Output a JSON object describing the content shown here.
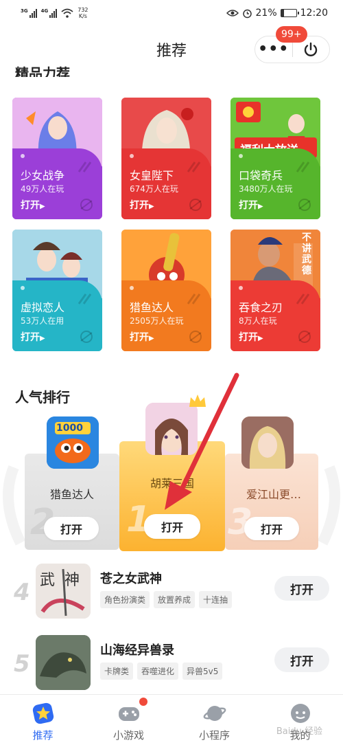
{
  "status_bar": {
    "signal1": "3G",
    "signal2": "4G",
    "speed_value": "732",
    "speed_unit": "K/s",
    "battery": "21%",
    "battery_level": 0.21,
    "time": "12:20"
  },
  "header": {
    "title": "推荐",
    "more_label": "•••",
    "badge": "99+"
  },
  "featured": {
    "section_title": "精品力荐",
    "games": [
      {
        "name": "少女战争",
        "count": "49万人在玩",
        "open": "打开",
        "color": "#9b3fd8",
        "art": "anime-warrior-girl"
      },
      {
        "name": "女皇陛下",
        "count": "674万人在玩",
        "open": "打开",
        "color": "#e53535",
        "art": "empress-girl"
      },
      {
        "name": "口袋奇兵",
        "count": "3480万人在玩",
        "open": "打开",
        "color": "#56b52c",
        "art": "welfare-banner",
        "art_text": "福利大放送"
      },
      {
        "name": "虚拟恋人",
        "count": "53万人在用",
        "open": "打开",
        "color": "#25b5c7",
        "art": "anime-couple"
      },
      {
        "name": "猎鱼达人",
        "count": "2505万人在玩",
        "open": "打开",
        "color": "#f27a1f",
        "art": "fishing-cannon"
      },
      {
        "name": "吞食之刃",
        "count": "8万人在玩",
        "open": "打开",
        "color": "#ec3b35",
        "art": "warrior-general",
        "art_text": "不讲武德"
      }
    ]
  },
  "ranking": {
    "section_title": "人气排行",
    "podium": [
      {
        "rank": "2",
        "name": "猎鱼达人",
        "open": "打开",
        "art": "fish-1000",
        "art_text": "1000"
      },
      {
        "rank": "1",
        "name": "胡莱三国",
        "open": "打开",
        "art": "anime-girl-crown"
      },
      {
        "rank": "3",
        "name": "爱江山更…",
        "open": "打开",
        "art": "blonde-lady"
      }
    ],
    "list": [
      {
        "rank": "4",
        "name": "苍之女武神",
        "tags": [
          "角色扮演类",
          "放置养成",
          "十连抽"
        ],
        "open": "打开",
        "art": "wushen-calligraphy",
        "art_text": "武神"
      },
      {
        "rank": "5",
        "name": "山海经异兽录",
        "tags": [
          "卡牌类",
          "吞噬进化",
          "异兽5v5"
        ],
        "open": "打开",
        "art": "dragon"
      }
    ]
  },
  "tabbar": {
    "tabs": [
      {
        "label": "推荐",
        "icon": "star-icon",
        "active": true
      },
      {
        "label": "小游戏",
        "icon": "gamepad-icon",
        "active": false
      },
      {
        "label": "小程序",
        "icon": "planet-icon",
        "active": false
      },
      {
        "label": "我的",
        "icon": "profile-icon",
        "active": false
      }
    ]
  },
  "watermark": "Baidu 经验",
  "colors": {
    "accent": "#2f6bf2",
    "badge": "#f04a3a",
    "annotation_arrow": "#e0303a"
  }
}
